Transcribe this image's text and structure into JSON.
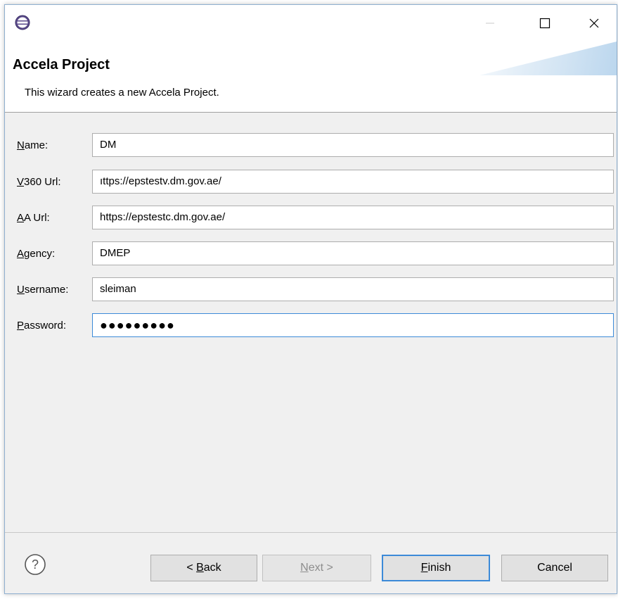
{
  "window": {
    "title": "",
    "controls": {
      "minimize": "—",
      "maximize": "☐",
      "close": "✕"
    }
  },
  "header": {
    "title": "Accela Project",
    "description": "This wizard creates a new Accela Project."
  },
  "form": {
    "fields": [
      {
        "label_mnemonic": "N",
        "label_rest": "ame:",
        "value": "DM"
      },
      {
        "label_mnemonic": "V",
        "label_rest": "360 Url:",
        "value": "ıttps://epstestv.dm.gov.ae/"
      },
      {
        "label_mnemonic": "A",
        "label_rest": "A Url:",
        "value": "https://epstestc.dm.gov.ae/"
      },
      {
        "label_mnemonic": "A",
        "label_rest": "gency:",
        "value": "DMEP"
      },
      {
        "label_mnemonic": "U",
        "label_rest": "sername:",
        "value": "sleiman"
      },
      {
        "label_mnemonic": "P",
        "label_rest": "assword:",
        "value": "●●●●●●●●●"
      }
    ]
  },
  "buttons": {
    "back_prefix": "< ",
    "back_mnemonic": "B",
    "back_rest": "ack",
    "next_mnemonic": "N",
    "next_rest": "ext >",
    "finish_mnemonic": "F",
    "finish_rest": "inish",
    "cancel": "Cancel"
  },
  "colors": {
    "accent": "#3c8ad8",
    "disabled_text": "#8d8d8d"
  },
  "icons": {
    "app": "eclipse-icon",
    "help": "help-icon"
  }
}
